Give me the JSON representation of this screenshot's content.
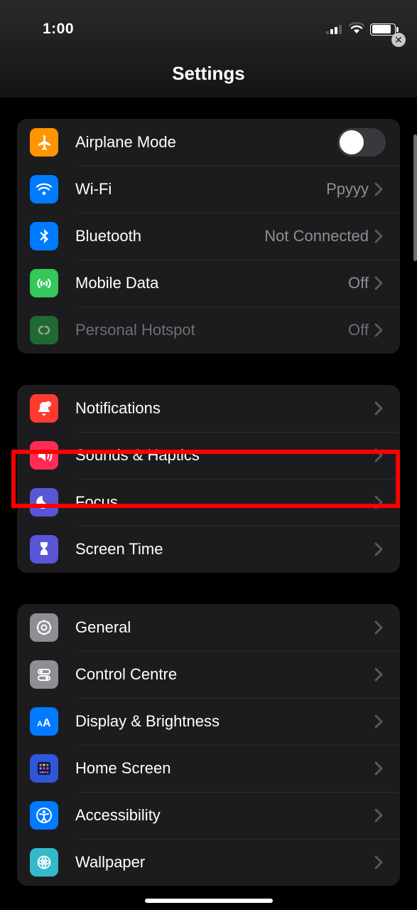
{
  "status": {
    "time": "1:00"
  },
  "header": {
    "title": "Settings"
  },
  "groups": [
    {
      "items": [
        {
          "id": "airplane",
          "label": "Airplane Mode",
          "icon_bg": "#ff9500",
          "hasToggle": true,
          "toggle": false
        },
        {
          "id": "wifi",
          "label": "Wi-Fi",
          "icon_bg": "#007aff",
          "value": "Ppyyy",
          "disclosure": true
        },
        {
          "id": "bluetooth",
          "label": "Bluetooth",
          "icon_bg": "#007aff",
          "value": "Not Connected",
          "disclosure": true
        },
        {
          "id": "mobile",
          "label": "Mobile Data",
          "icon_bg": "#34c759",
          "value": "Off",
          "disclosure": true
        },
        {
          "id": "hotspot",
          "label": "Personal Hotspot",
          "icon_bg": "#1f6a32",
          "value": "Off",
          "disclosure": true,
          "disabled": true
        }
      ]
    },
    {
      "items": [
        {
          "id": "notifications",
          "label": "Notifications",
          "icon_bg": "#ff3b30",
          "disclosure": true
        },
        {
          "id": "sounds",
          "label": "Sounds & Haptics",
          "icon_bg": "#ff2d55",
          "disclosure": true,
          "highlighted": true
        },
        {
          "id": "focus",
          "label": "Focus",
          "icon_bg": "#5856d6",
          "disclosure": true
        },
        {
          "id": "screentime",
          "label": "Screen Time",
          "icon_bg": "#5856d6",
          "disclosure": true
        }
      ]
    },
    {
      "items": [
        {
          "id": "general",
          "label": "General",
          "icon_bg": "#8e8e93",
          "disclosure": true
        },
        {
          "id": "controlcentre",
          "label": "Control Centre",
          "icon_bg": "#8e8e93",
          "disclosure": true
        },
        {
          "id": "display",
          "label": "Display & Brightness",
          "icon_bg": "#007aff",
          "disclosure": true
        },
        {
          "id": "homescreen",
          "label": "Home Screen",
          "icon_bg": "#2f57d8",
          "disclosure": true
        },
        {
          "id": "accessibility",
          "label": "Accessibility",
          "icon_bg": "#007aff",
          "disclosure": true
        },
        {
          "id": "wallpaper",
          "label": "Wallpaper",
          "icon_bg": "#33b9c9",
          "disclosure": true
        }
      ]
    }
  ]
}
